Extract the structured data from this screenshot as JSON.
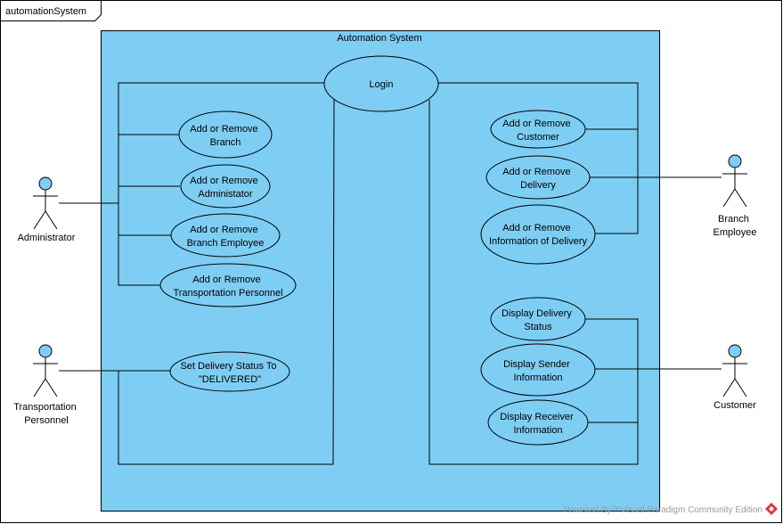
{
  "frame": {
    "title": "automationSystem"
  },
  "system": {
    "title": "Automation System"
  },
  "use_cases": {
    "login": [
      "Login"
    ],
    "add_remove_branch": [
      "Add or Remove",
      "Branch"
    ],
    "add_remove_administator": [
      "Add or Remove",
      "Administator"
    ],
    "add_remove_branch_employee": [
      "Add or Remove",
      "Branch Employee"
    ],
    "add_remove_transportation_personnel": [
      "Add or Remove",
      "Transportation Personnel"
    ],
    "set_delivery_status": [
      "Set Delivery Status To",
      "\"DELIVERED\""
    ],
    "add_remove_customer": [
      "Add or Remove",
      "Customer"
    ],
    "add_remove_delivery": [
      "Add or Remove",
      "Delivery"
    ],
    "add_remove_information_of_delivery": [
      "Add or Remove",
      "Information of Delivery"
    ],
    "display_delivery_status": [
      "Display Delivery",
      "Status"
    ],
    "display_sender_information": [
      "Display Sender",
      "Information"
    ],
    "display_receiver_information": [
      "Display Receiver",
      "Information"
    ]
  },
  "actors": {
    "administrator": [
      "Administrator"
    ],
    "transportation_personnel": [
      "Transportation",
      "Personnel"
    ],
    "branch_employee": [
      "Branch",
      "Employee"
    ],
    "customer": [
      "Customer"
    ]
  },
  "watermark": {
    "text": "Powered By™Visual Paradigm Community Edition"
  },
  "colors": {
    "system_fill": "#7ecef4",
    "use_case_fill": "#7ecef4",
    "actor_head_fill": "#7ecef4"
  }
}
